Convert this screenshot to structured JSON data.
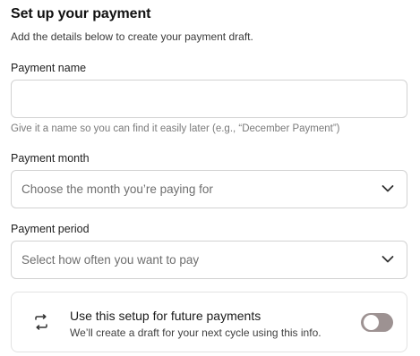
{
  "form": {
    "title": "Set up your payment",
    "subtitle": "Add the details below to create your payment draft.",
    "payment_name": {
      "label": "Payment name",
      "value": "",
      "helper": "Give it a name so you can find it easily later (e.g., “December Payment”)"
    },
    "payment_month": {
      "label": "Payment month",
      "placeholder": "Choose the month you’re paying for"
    },
    "payment_period": {
      "label": "Payment period",
      "placeholder": "Select how often you want to pay"
    },
    "recurring": {
      "icon": "repeat-icon",
      "title": "Use this setup for future payments",
      "description": "We’ll create a draft for your next cycle using this info.",
      "enabled": false
    }
  },
  "colors": {
    "toggle_off": "#9d9292",
    "border": "#d2d2d2",
    "helper_text": "#7a7a7a"
  }
}
